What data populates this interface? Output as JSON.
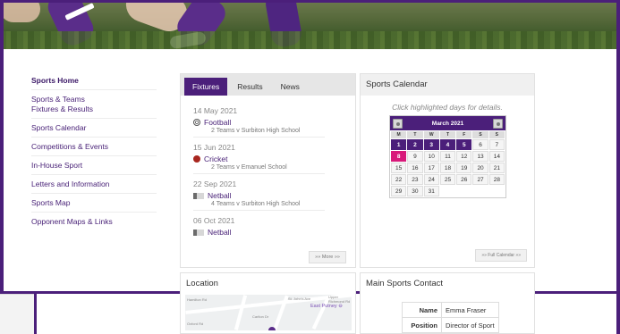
{
  "sidebar": {
    "items": [
      {
        "label": "Sports Home"
      },
      {
        "label": "Sports & Teams\nFixtures & Results"
      },
      {
        "label": "Sports Calendar"
      },
      {
        "label": "Competitions & Events"
      },
      {
        "label": "In-House Sport"
      },
      {
        "label": "Letters and Information"
      },
      {
        "label": "Sports Map"
      },
      {
        "label": "Opponent Maps & Links"
      }
    ]
  },
  "fixtures_panel": {
    "tabs": [
      "Fixtures",
      "Results",
      "News"
    ],
    "items": [
      {
        "date": "14 May 2021",
        "sport": "Football",
        "icon": "football-icon",
        "detail": "2 Teams v Surbiton High School"
      },
      {
        "date": "15 Jun 2021",
        "sport": "Cricket",
        "icon": "cricket-ball-icon",
        "detail": "2 Teams v Emanuel School"
      },
      {
        "date": "22 Sep 2021",
        "sport": "Netball",
        "icon": "netball-icon",
        "detail": "4 Teams v Surbiton High School"
      },
      {
        "date": "06 Oct 2021",
        "sport": "Netball",
        "icon": "netball-icon",
        "detail": ""
      }
    ],
    "more_label": "»» More »»"
  },
  "calendar": {
    "title": "Sports Calendar",
    "hint": "Click highlighted days for details.",
    "month": "March 2021",
    "dow": [
      "M",
      "T",
      "W",
      "T",
      "F",
      "S",
      "S"
    ],
    "weeks": [
      [
        "1",
        "2",
        "3",
        "4",
        "5",
        "6",
        "7"
      ],
      [
        "8",
        "9",
        "10",
        "11",
        "12",
        "13",
        "14"
      ],
      [
        "15",
        "16",
        "17",
        "18",
        "19",
        "20",
        "21"
      ],
      [
        "22",
        "23",
        "24",
        "25",
        "26",
        "27",
        "28"
      ],
      [
        "29",
        "30",
        "31",
        "",
        "",
        "",
        ""
      ]
    ],
    "highlighted": [
      "1",
      "2",
      "3",
      "4",
      "5"
    ],
    "today": "8",
    "full_label": "»» Full Calendar »»"
  },
  "location": {
    "title": "Location",
    "station": "East Putney",
    "streets": [
      "Upper Richmond Rd",
      "St. John's Ave",
      "Carlton Dr",
      "Oxford Rd",
      "Hamilton Rd"
    ]
  },
  "contact": {
    "title": "Main Sports Contact",
    "rows": [
      {
        "key": "Name",
        "value": "Emma Fraser"
      },
      {
        "key": "Position",
        "value": "Director of Sport"
      }
    ]
  },
  "colors": {
    "brand": "#4b1f7a",
    "today": "#d8197a"
  }
}
